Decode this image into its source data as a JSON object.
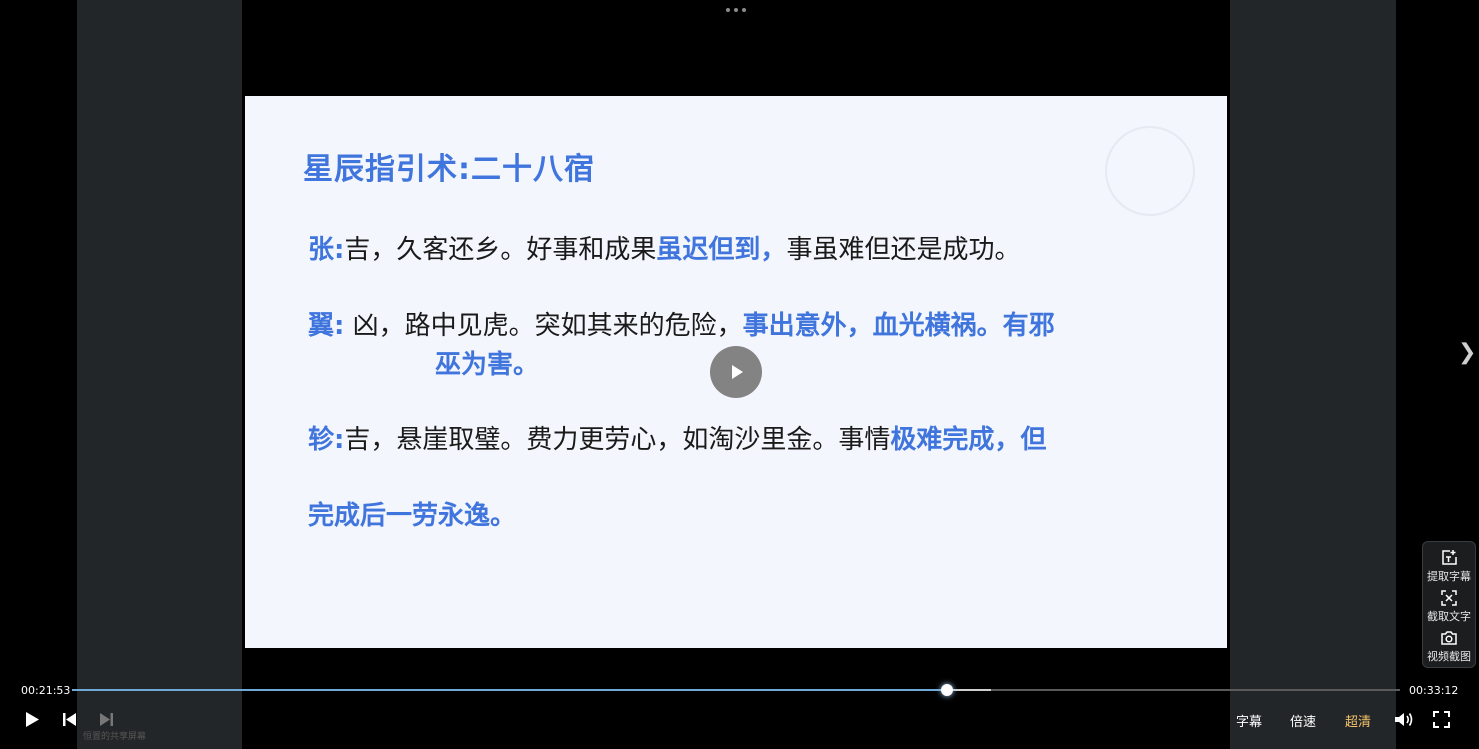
{
  "slide": {
    "title": "星辰指引术:二十八宿",
    "entries": [
      {
        "term": "张:",
        "text": "吉，久客还乡。好事和成果",
        "highlight": "虽迟但到，",
        "after": "事虽难但还是成功。"
      },
      {
        "term": "翼:",
        "text": " 凶，路中见虎。突如其来的危险，",
        "highlight": "事出意外，血光横祸。有邪",
        "after": "",
        "continuation": "巫为害。"
      },
      {
        "term": "轸:",
        "text": "吉，悬崖取璧。费力更劳心，如淘沙里金。事情",
        "highlight": "极难完成，但",
        "after": "",
        "continuation": "完成后一劳永逸。"
      }
    ]
  },
  "player": {
    "current_time": "00:21:53",
    "total_time": "00:33:12",
    "progress_fraction": 0.659,
    "buffered_fraction": 0.692,
    "controls": {
      "subtitle_label": "字幕",
      "speed_label": "倍速",
      "quality_label": "超清"
    },
    "watermark": "恒置的共享屏幕",
    "accent_color": "#6fa9d8",
    "quality_color": "#f2c36b"
  },
  "tools": [
    {
      "label": "提取字幕",
      "icon": "extract-subtitle-icon"
    },
    {
      "label": "截取文字",
      "icon": "capture-text-icon"
    },
    {
      "label": "视频截图",
      "icon": "camera-icon"
    }
  ]
}
